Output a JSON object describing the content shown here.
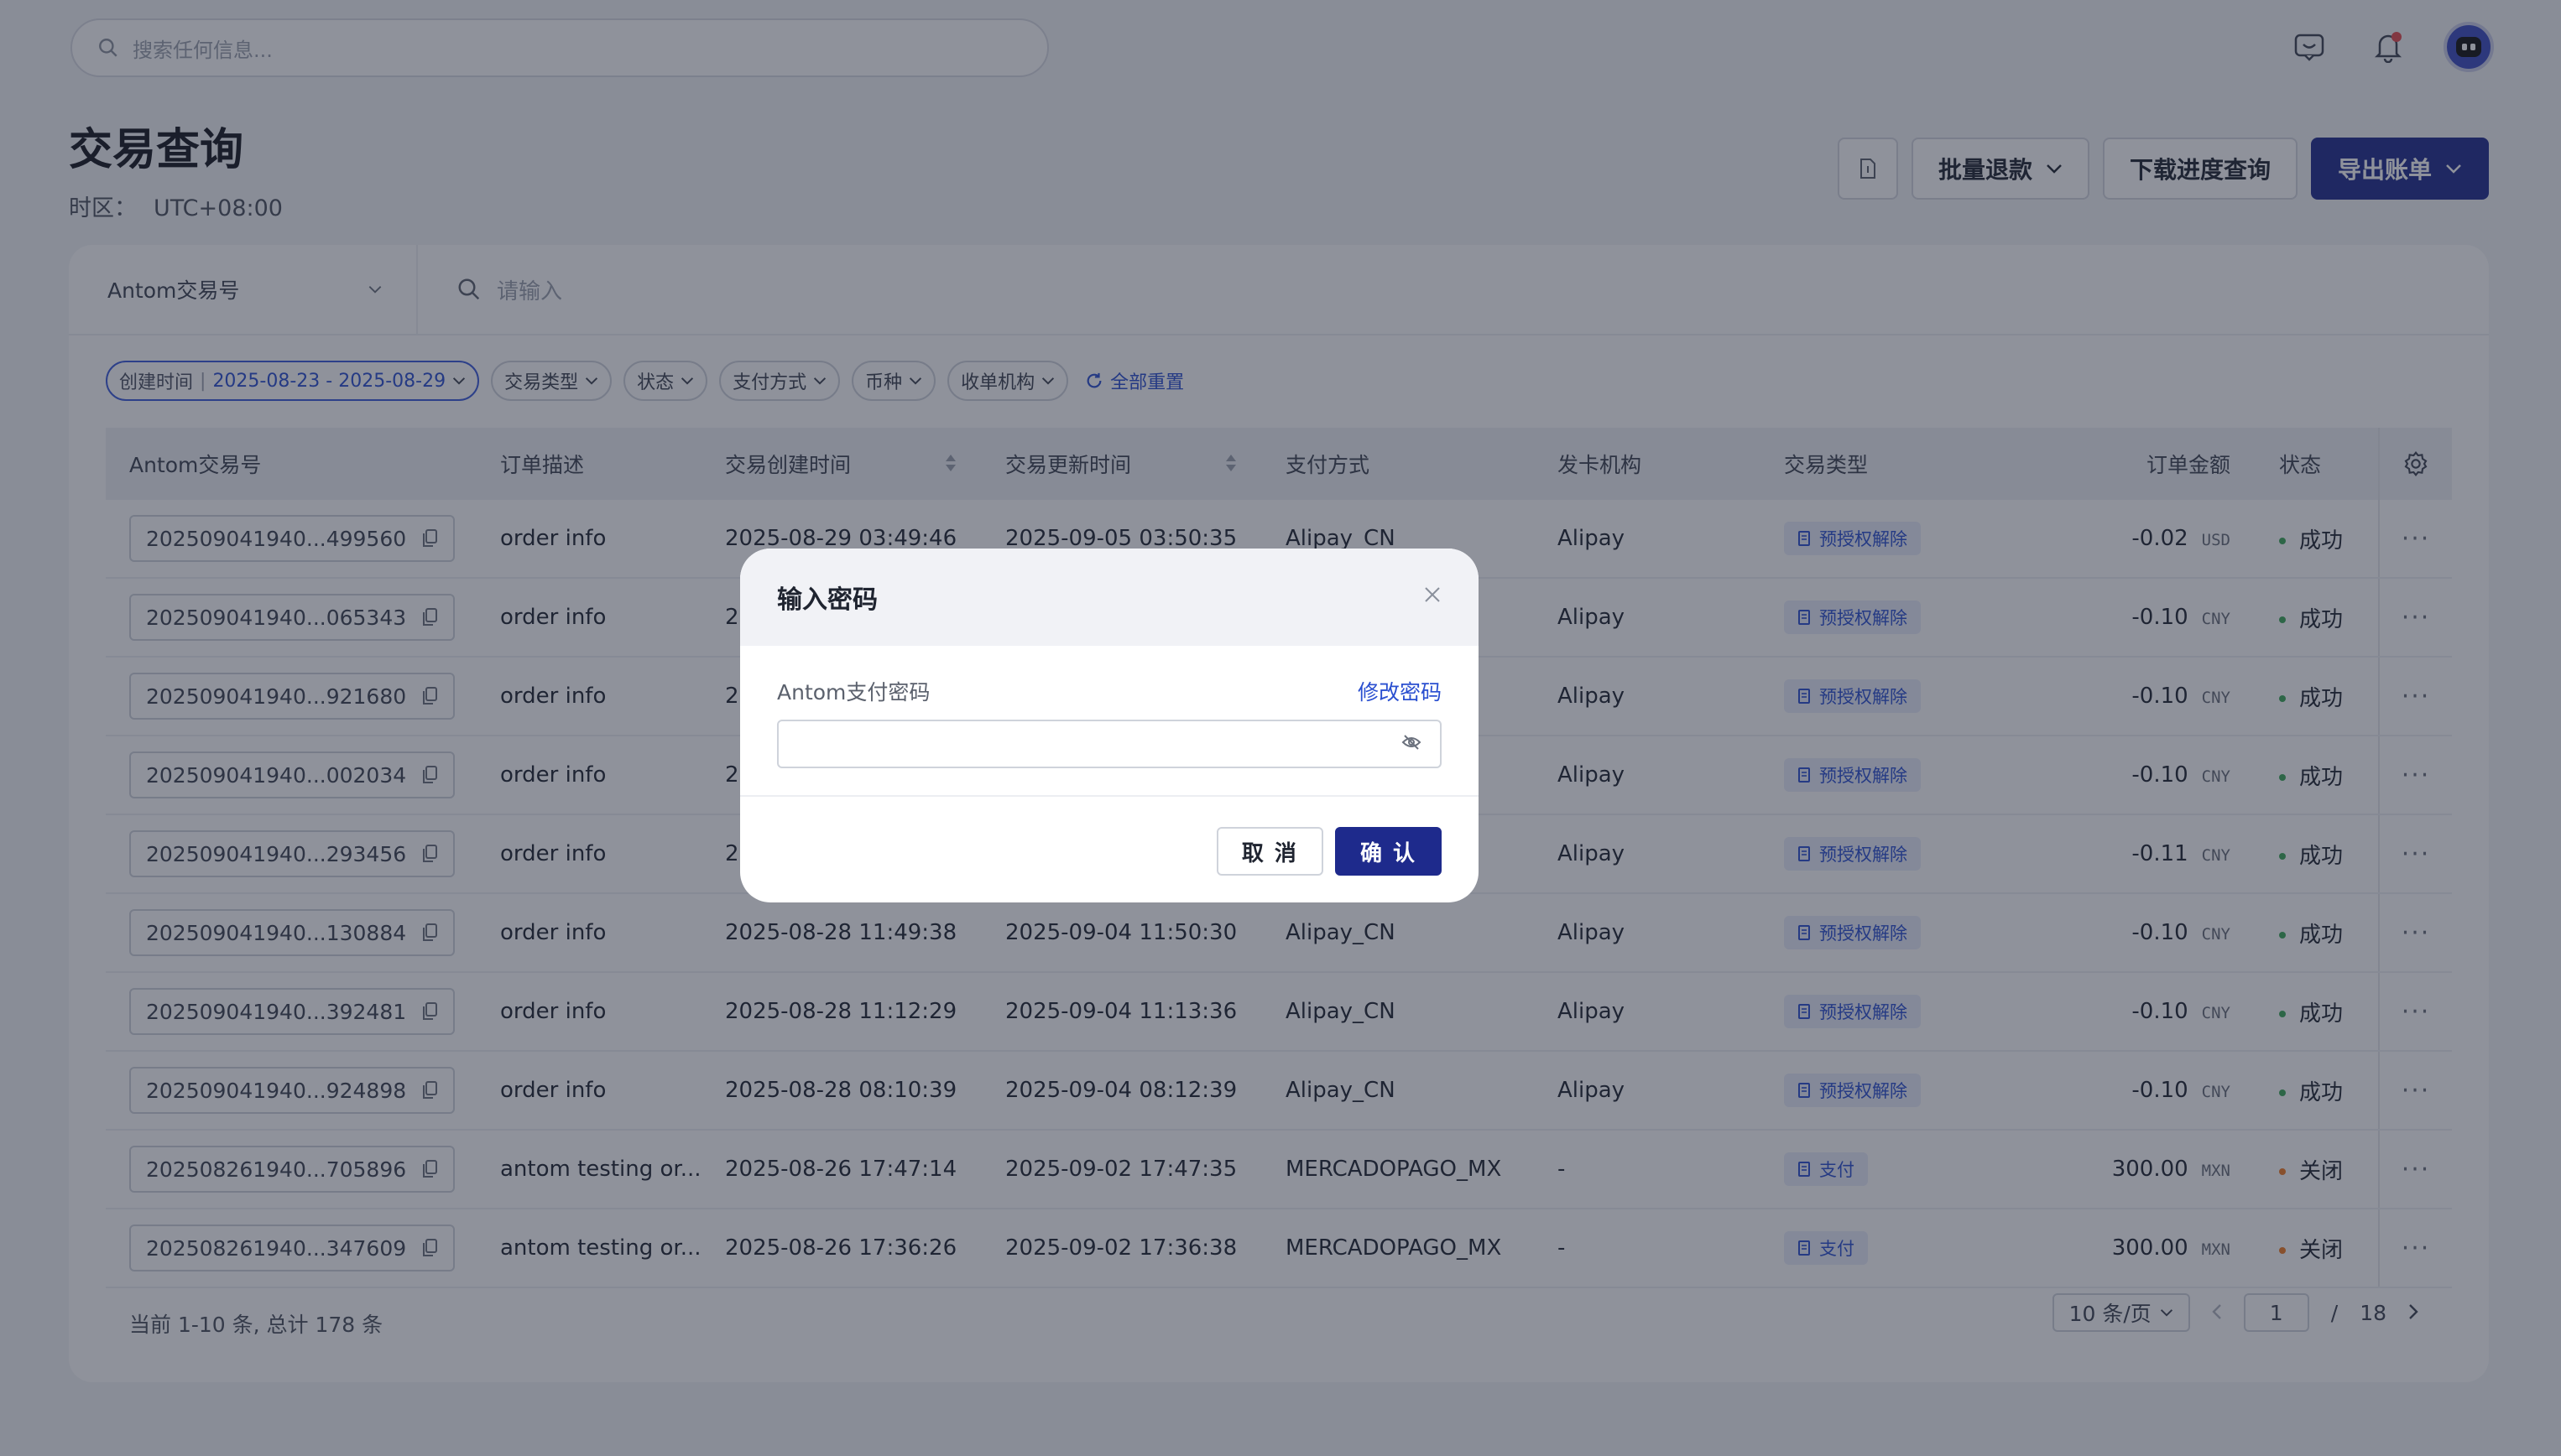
{
  "search": {
    "placeholder": "搜索任何信息..."
  },
  "page": {
    "title": "交易查询",
    "tz_label": "时区：",
    "tz_value": "UTC+08:00"
  },
  "actions": {
    "batch_refund": "批量退款",
    "download_progress": "下载进度查询",
    "export": "导出账单"
  },
  "query": {
    "field": "Antom交易号",
    "placeholder": "请输入"
  },
  "filters": {
    "created_label": "创建时间",
    "created_value": "2025-08-23 - 2025-08-29",
    "chips": [
      "交易类型",
      "状态",
      "支付方式",
      "币种",
      "收单机构"
    ],
    "reset": "全部重置"
  },
  "table": {
    "headers": [
      "Antom交易号",
      "订单描述",
      "交易创建时间",
      "交易更新时间",
      "支付方式",
      "发卡机构",
      "交易类型",
      "订单金额",
      "状态"
    ],
    "rows": [
      {
        "id": "202509041940...499560",
        "desc": "order info",
        "created": "2025-08-29 03:49:46",
        "updated": "2025-09-05 03:50:35",
        "method": "Alipay_CN",
        "issuer": "Alipay",
        "type": "预授权解除",
        "amount": "-0.02",
        "currency": "USD",
        "status": "成功"
      },
      {
        "id": "202509041940...065343",
        "desc": "order info",
        "created": "2",
        "updated": "",
        "method": "",
        "issuer": "Alipay",
        "type": "预授权解除",
        "amount": "-0.10",
        "currency": "CNY",
        "status": "成功"
      },
      {
        "id": "202509041940...921680",
        "desc": "order info",
        "created": "2",
        "updated": "",
        "method": "",
        "issuer": "Alipay",
        "type": "预授权解除",
        "amount": "-0.10",
        "currency": "CNY",
        "status": "成功"
      },
      {
        "id": "202509041940...002034",
        "desc": "order info",
        "created": "2",
        "updated": "",
        "method": "",
        "issuer": "Alipay",
        "type": "预授权解除",
        "amount": "-0.10",
        "currency": "CNY",
        "status": "成功"
      },
      {
        "id": "202509041940...293456",
        "desc": "order info",
        "created": "2",
        "updated": "",
        "method": "",
        "issuer": "Alipay",
        "type": "预授权解除",
        "amount": "-0.11",
        "currency": "CNY",
        "status": "成功"
      },
      {
        "id": "202509041940...130884",
        "desc": "order info",
        "created": "2025-08-28 11:49:38",
        "updated": "2025-09-04 11:50:30",
        "method": "Alipay_CN",
        "issuer": "Alipay",
        "type": "预授权解除",
        "amount": "-0.10",
        "currency": "CNY",
        "status": "成功"
      },
      {
        "id": "202509041940...392481",
        "desc": "order info",
        "created": "2025-08-28 11:12:29",
        "updated": "2025-09-04 11:13:36",
        "method": "Alipay_CN",
        "issuer": "Alipay",
        "type": "预授权解除",
        "amount": "-0.10",
        "currency": "CNY",
        "status": "成功"
      },
      {
        "id": "202509041940...924898",
        "desc": "order info",
        "created": "2025-08-28 08:10:39",
        "updated": "2025-09-04 08:12:39",
        "method": "Alipay_CN",
        "issuer": "Alipay",
        "type": "预授权解除",
        "amount": "-0.10",
        "currency": "CNY",
        "status": "成功"
      },
      {
        "id": "202508261940...705896",
        "desc": "antom testing or...",
        "created": "2025-08-26 17:47:14",
        "updated": "2025-09-02 17:47:35",
        "method": "MERCADOPAGO_MX",
        "issuer": "-",
        "type": "支付",
        "amount": "300.00",
        "currency": "MXN",
        "status": "关闭"
      },
      {
        "id": "202508261940...347609",
        "desc": "antom testing or...",
        "created": "2025-08-26 17:36:26",
        "updated": "2025-09-02 17:36:38",
        "method": "MERCADOPAGO_MX",
        "issuer": "-",
        "type": "支付",
        "amount": "300.00",
        "currency": "MXN",
        "status": "关闭"
      }
    ]
  },
  "footer": {
    "summary": "当前 1-10 条, 总计 178 条",
    "page_size": "10 条/页",
    "current_page": "1",
    "separator": "/",
    "total_pages": "18"
  },
  "modal": {
    "title": "输入密码",
    "label": "Antom支付密码",
    "link": "修改密码",
    "cancel": "取 消",
    "confirm": "确 认"
  },
  "colors": {
    "primary": "#1e2a8c",
    "link": "#2a4fd0",
    "success": "#3aa757",
    "closed": "#f07a22"
  }
}
